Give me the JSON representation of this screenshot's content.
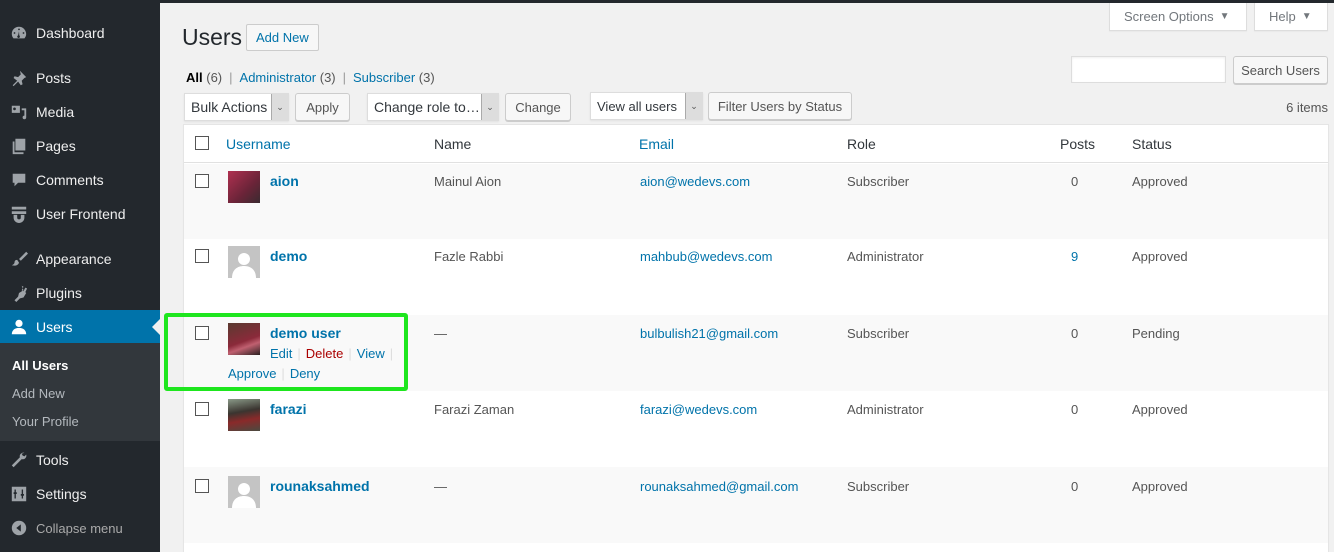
{
  "sidebar": {
    "items": [
      {
        "label": "Dashboard",
        "icon": "dashboard-icon"
      },
      {
        "label": "Posts",
        "icon": "pushpin-icon"
      },
      {
        "label": "Media",
        "icon": "media-icon"
      },
      {
        "label": "Pages",
        "icon": "pages-icon"
      },
      {
        "label": "Comments",
        "icon": "comment-icon"
      },
      {
        "label": "User Frontend",
        "icon": "user-frontend-icon"
      },
      {
        "label": "Appearance",
        "icon": "paintbrush-icon"
      },
      {
        "label": "Plugins",
        "icon": "plugin-icon"
      },
      {
        "label": "Users",
        "icon": "user-icon",
        "active": true
      },
      {
        "label": "Tools",
        "icon": "wrench-icon"
      },
      {
        "label": "Settings",
        "icon": "settings-icon"
      },
      {
        "label": "Collapse menu",
        "icon": "collapse-icon"
      }
    ],
    "submenu": [
      {
        "label": "All Users",
        "current": true
      },
      {
        "label": "Add New"
      },
      {
        "label": "Your Profile"
      }
    ]
  },
  "header": {
    "title": "Users",
    "add_new": "Add New",
    "screen_options": "Screen Options",
    "help": "Help"
  },
  "filters": {
    "views": [
      {
        "label": "All",
        "count": "(6)"
      },
      {
        "label": "Administrator",
        "count": "(3)"
      },
      {
        "label": "Subscriber",
        "count": "(3)"
      }
    ],
    "bulk_actions": "Bulk Actions",
    "apply": "Apply",
    "change_role": "Change role to…",
    "change": "Change",
    "view_users": "View all users",
    "filter_status": "Filter Users by Status",
    "search_value": "",
    "search_button": "Search Users",
    "items_count": "6 items"
  },
  "table": {
    "columns": [
      "Username",
      "Name",
      "Email",
      "Role",
      "Posts",
      "Status"
    ],
    "rows": [
      {
        "username": "aion",
        "name": "Mainul Aion",
        "email": "aion@wedevs.com",
        "role": "Subscriber",
        "posts": "0",
        "status": "Approved",
        "avatar": "photo"
      },
      {
        "username": "demo",
        "name": "Fazle Rabbi",
        "email": "mahbub@wedevs.com",
        "role": "Administrator",
        "posts": "9",
        "status": "Approved",
        "avatar": "default"
      },
      {
        "username": "demo user",
        "name": "—",
        "email": "bulbulish21@gmail.com",
        "role": "Subscriber",
        "posts": "0",
        "status": "Pending",
        "avatar": "photo",
        "actions": [
          "Edit",
          "Delete",
          "View",
          "Approve",
          "Deny"
        ]
      },
      {
        "username": "farazi",
        "name": "Farazi Zaman",
        "email": "farazi@wedevs.com",
        "role": "Administrator",
        "posts": "0",
        "status": "Approved",
        "avatar": "photo"
      },
      {
        "username": "rounaksahmed",
        "name": "—",
        "email": "rounaksahmed@gmail.com",
        "role": "Subscriber",
        "posts": "0",
        "status": "Approved",
        "avatar": "default"
      }
    ]
  },
  "colors": {
    "sidebar_bg": "#23282d",
    "active": "#0073aa",
    "link": "#0073aa",
    "delete": "#aa0000",
    "highlight": "#1ee61e"
  }
}
